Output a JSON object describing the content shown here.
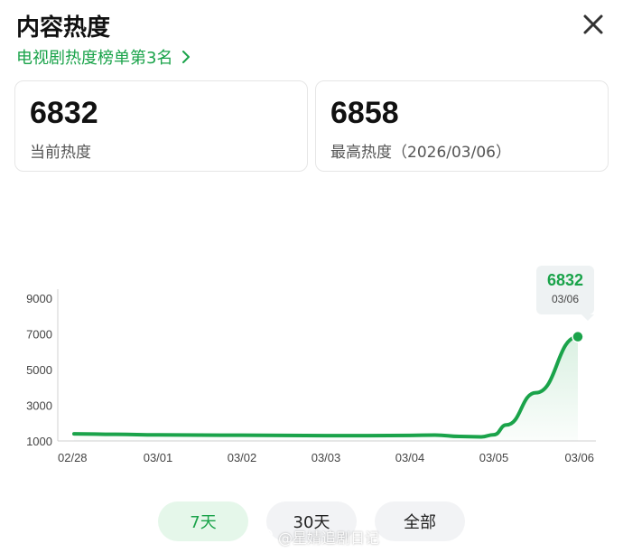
{
  "header": {
    "title": "内容热度",
    "rank_link": "电视剧热度榜单第3名"
  },
  "cards": [
    {
      "value": "6832",
      "label": "当前热度"
    },
    {
      "value": "6858",
      "label": "最高热度（2026/03/06）"
    }
  ],
  "tooltip": {
    "value": "6832",
    "date": "03/06"
  },
  "range_buttons": [
    "7天",
    "30天",
    "全部"
  ],
  "selected_range": "7天",
  "watermark": "@星婧追剧日记",
  "colors": {
    "accent": "#1aa34a",
    "selected_bg": "#e5f7ea",
    "button_bg": "#f2f3f5"
  },
  "chart_data": {
    "type": "line",
    "x": [
      "02/28",
      "03/01",
      "03/02",
      "03/03",
      "03/04",
      "03/05",
      "03/06"
    ],
    "y_ticks": [
      1000,
      3000,
      5000,
      7000,
      9000
    ],
    "ylim": [
      1000,
      10000
    ],
    "series": [
      {
        "x_pos": [
          0,
          0.5,
          1,
          1.5,
          2,
          2.5,
          3,
          3.5,
          4,
          4.3,
          4.6,
          4.85,
          5,
          5.15,
          5.5,
          6
        ],
        "values": [
          1400,
          1370,
          1340,
          1330,
          1320,
          1310,
          1300,
          1300,
          1310,
          1330,
          1250,
          1230,
          1350,
          1900,
          3700,
          6832
        ]
      }
    ],
    "grid": false,
    "highlight": {
      "x": "03/06",
      "value": 6832
    }
  }
}
